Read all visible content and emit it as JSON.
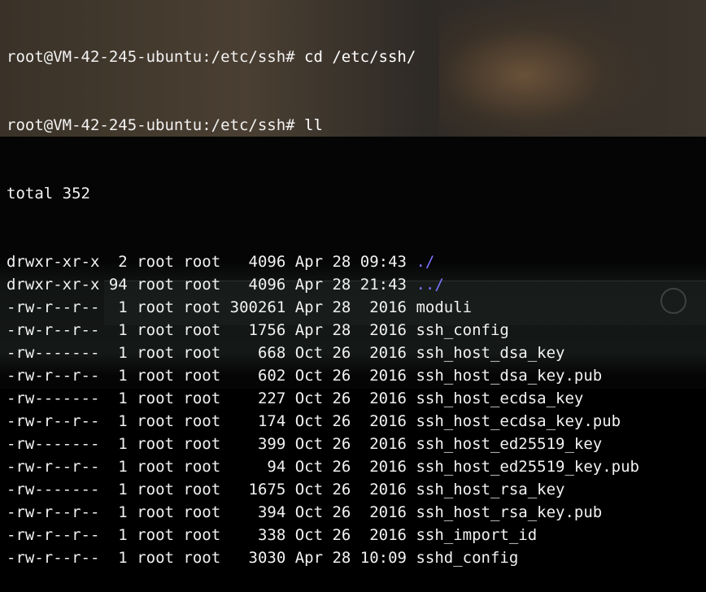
{
  "prompt_lines": [
    {
      "prompt": "root@VM-42-245-ubuntu:/etc/ssh# ",
      "command": "cd /etc/ssh/"
    },
    {
      "prompt": "root@VM-42-245-ubuntu:/etc/ssh# ",
      "command": "ll"
    }
  ],
  "total_line": "total 352",
  "colors": {
    "directory": "#7b73ff",
    "text": "#f2f2f2",
    "background": "#000000"
  },
  "listing": [
    {
      "perms": "drwxr-xr-x",
      "links": " 2",
      "owner": "root",
      "group": "root",
      "size": "  4096",
      "date": "Apr 28 09:43",
      "name": "./",
      "type": "dir"
    },
    {
      "perms": "drwxr-xr-x",
      "links": "94",
      "owner": "root",
      "group": "root",
      "size": "  4096",
      "date": "Apr 28 21:43",
      "name": "../",
      "type": "dir"
    },
    {
      "perms": "-rw-r--r--",
      "links": " 1",
      "owner": "root",
      "group": "root",
      "size": "300261",
      "date": "Apr 28  2016",
      "name": "moduli",
      "type": "file"
    },
    {
      "perms": "-rw-r--r--",
      "links": " 1",
      "owner": "root",
      "group": "root",
      "size": "  1756",
      "date": "Apr 28  2016",
      "name": "ssh_config",
      "type": "file"
    },
    {
      "perms": "-rw-------",
      "links": " 1",
      "owner": "root",
      "group": "root",
      "size": "   668",
      "date": "Oct 26  2016",
      "name": "ssh_host_dsa_key",
      "type": "file"
    },
    {
      "perms": "-rw-r--r--",
      "links": " 1",
      "owner": "root",
      "group": "root",
      "size": "   602",
      "date": "Oct 26  2016",
      "name": "ssh_host_dsa_key.pub",
      "type": "file"
    },
    {
      "perms": "-rw-------",
      "links": " 1",
      "owner": "root",
      "group": "root",
      "size": "   227",
      "date": "Oct 26  2016",
      "name": "ssh_host_ecdsa_key",
      "type": "file"
    },
    {
      "perms": "-rw-r--r--",
      "links": " 1",
      "owner": "root",
      "group": "root",
      "size": "   174",
      "date": "Oct 26  2016",
      "name": "ssh_host_ecdsa_key.pub",
      "type": "file"
    },
    {
      "perms": "-rw-------",
      "links": " 1",
      "owner": "root",
      "group": "root",
      "size": "   399",
      "date": "Oct 26  2016",
      "name": "ssh_host_ed25519_key",
      "type": "file"
    },
    {
      "perms": "-rw-r--r--",
      "links": " 1",
      "owner": "root",
      "group": "root",
      "size": "    94",
      "date": "Oct 26  2016",
      "name": "ssh_host_ed25519_key.pub",
      "type": "file"
    },
    {
      "perms": "-rw-------",
      "links": " 1",
      "owner": "root",
      "group": "root",
      "size": "  1675",
      "date": "Oct 26  2016",
      "name": "ssh_host_rsa_key",
      "type": "file"
    },
    {
      "perms": "-rw-r--r--",
      "links": " 1",
      "owner": "root",
      "group": "root",
      "size": "   394",
      "date": "Oct 26  2016",
      "name": "ssh_host_rsa_key.pub",
      "type": "file"
    },
    {
      "perms": "-rw-r--r--",
      "links": " 1",
      "owner": "root",
      "group": "root",
      "size": "   338",
      "date": "Oct 26  2016",
      "name": "ssh_import_id",
      "type": "file"
    },
    {
      "perms": "-rw-r--r--",
      "links": " 1",
      "owner": "root",
      "group": "root",
      "size": "  3030",
      "date": "Apr 28 10:09",
      "name": "sshd_config",
      "type": "file"
    }
  ]
}
